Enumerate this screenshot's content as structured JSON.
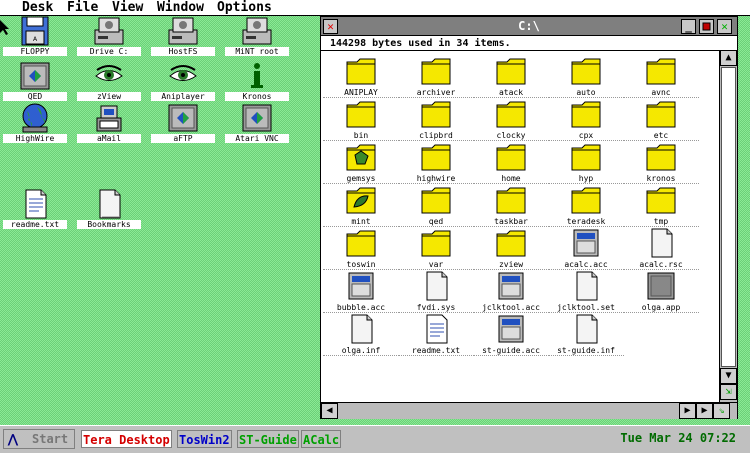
{
  "menubar": {
    "items": [
      "Desk",
      "File",
      "View",
      "Window",
      "Options"
    ]
  },
  "desktop_icons": [
    {
      "label": "FLOPPY",
      "icon": "floppy-icon"
    },
    {
      "label": "Drive C:",
      "icon": "hard-drive-icon"
    },
    {
      "label": "HostFS",
      "icon": "hard-drive-icon"
    },
    {
      "label": "MiNT root",
      "icon": "hard-drive-icon"
    },
    {
      "label": "QED",
      "icon": "application-icon"
    },
    {
      "label": "zView",
      "icon": "eye-icon"
    },
    {
      "label": "Aniplayer",
      "icon": "eye-icon"
    },
    {
      "label": "Kronos",
      "icon": "info-icon"
    },
    {
      "label": "HighWire",
      "icon": "globe-icon"
    },
    {
      "label": "aMail",
      "icon": "mail-icon"
    },
    {
      "label": "aFTP",
      "icon": "application-icon"
    },
    {
      "label": "Atari VNC",
      "icon": "application-icon"
    },
    {
      "label": "readme.txt",
      "icon": "text-document-icon"
    },
    {
      "label": "Bookmarks",
      "icon": "document-icon"
    }
  ],
  "window": {
    "title": "C:\\",
    "info": "144298 bytes used in 34 items.",
    "close_glyph": "✕",
    "iconify_glyph": "_",
    "fuller_glyph": "✕",
    "files": [
      {
        "name": "ANIPLAY",
        "icon": "folder-icon"
      },
      {
        "name": "archiver",
        "icon": "folder-icon"
      },
      {
        "name": "atack",
        "icon": "folder-icon"
      },
      {
        "name": "auto",
        "icon": "folder-icon"
      },
      {
        "name": "avnc",
        "icon": "folder-icon"
      },
      {
        "name": "bin",
        "icon": "folder-icon"
      },
      {
        "name": "clipbrd",
        "icon": "folder-icon"
      },
      {
        "name": "clocky",
        "icon": "folder-icon"
      },
      {
        "name": "cpx",
        "icon": "folder-icon"
      },
      {
        "name": "etc",
        "icon": "folder-icon"
      },
      {
        "name": "gemsys",
        "icon": "gemsys-folder-icon"
      },
      {
        "name": "highwire",
        "icon": "folder-icon"
      },
      {
        "name": "home",
        "icon": "folder-icon"
      },
      {
        "name": "hyp",
        "icon": "folder-icon"
      },
      {
        "name": "kronos",
        "icon": "folder-icon"
      },
      {
        "name": "mint",
        "icon": "mint-folder-icon"
      },
      {
        "name": "qed",
        "icon": "folder-icon"
      },
      {
        "name": "taskbar",
        "icon": "folder-icon"
      },
      {
        "name": "teradesk",
        "icon": "folder-icon"
      },
      {
        "name": "tmp",
        "icon": "folder-icon"
      },
      {
        "name": "toswin",
        "icon": "folder-icon"
      },
      {
        "name": "var",
        "icon": "folder-icon"
      },
      {
        "name": "zview",
        "icon": "folder-icon"
      },
      {
        "name": "acalc.acc",
        "icon": "program-icon"
      },
      {
        "name": "acalc.rsc",
        "icon": "document-icon"
      },
      {
        "name": "bubble.acc",
        "icon": "program-icon"
      },
      {
        "name": "fvdi.sys",
        "icon": "document-icon"
      },
      {
        "name": "jclktool.acc",
        "icon": "program-icon"
      },
      {
        "name": "jclktool.set",
        "icon": "document-icon"
      },
      {
        "name": "olga.app",
        "icon": "application-icon"
      },
      {
        "name": "olga.inf",
        "icon": "document-icon"
      },
      {
        "name": "readme.txt",
        "icon": "text-document-icon"
      },
      {
        "name": "st-guide.acc",
        "icon": "program-icon"
      },
      {
        "name": "st-guide.inf",
        "icon": "document-icon"
      }
    ]
  },
  "taskbar": {
    "start_label": "Start",
    "tasks": [
      {
        "label": "Tera Desktop",
        "color": "#d40000"
      },
      {
        "label": "TosWin2",
        "color": "#0000c8"
      },
      {
        "label": "ST-Guide",
        "color": "#00a000"
      },
      {
        "label": "ACalc",
        "color": "#00a000"
      }
    ],
    "clock": "Tue Mar 24 07:22"
  },
  "colors": {
    "desktop": "#7ee28a",
    "folder": "#f5e800",
    "titlebar": "#7f7f7f",
    "close_red": "#e00000",
    "fuller_green": "#00b000"
  }
}
